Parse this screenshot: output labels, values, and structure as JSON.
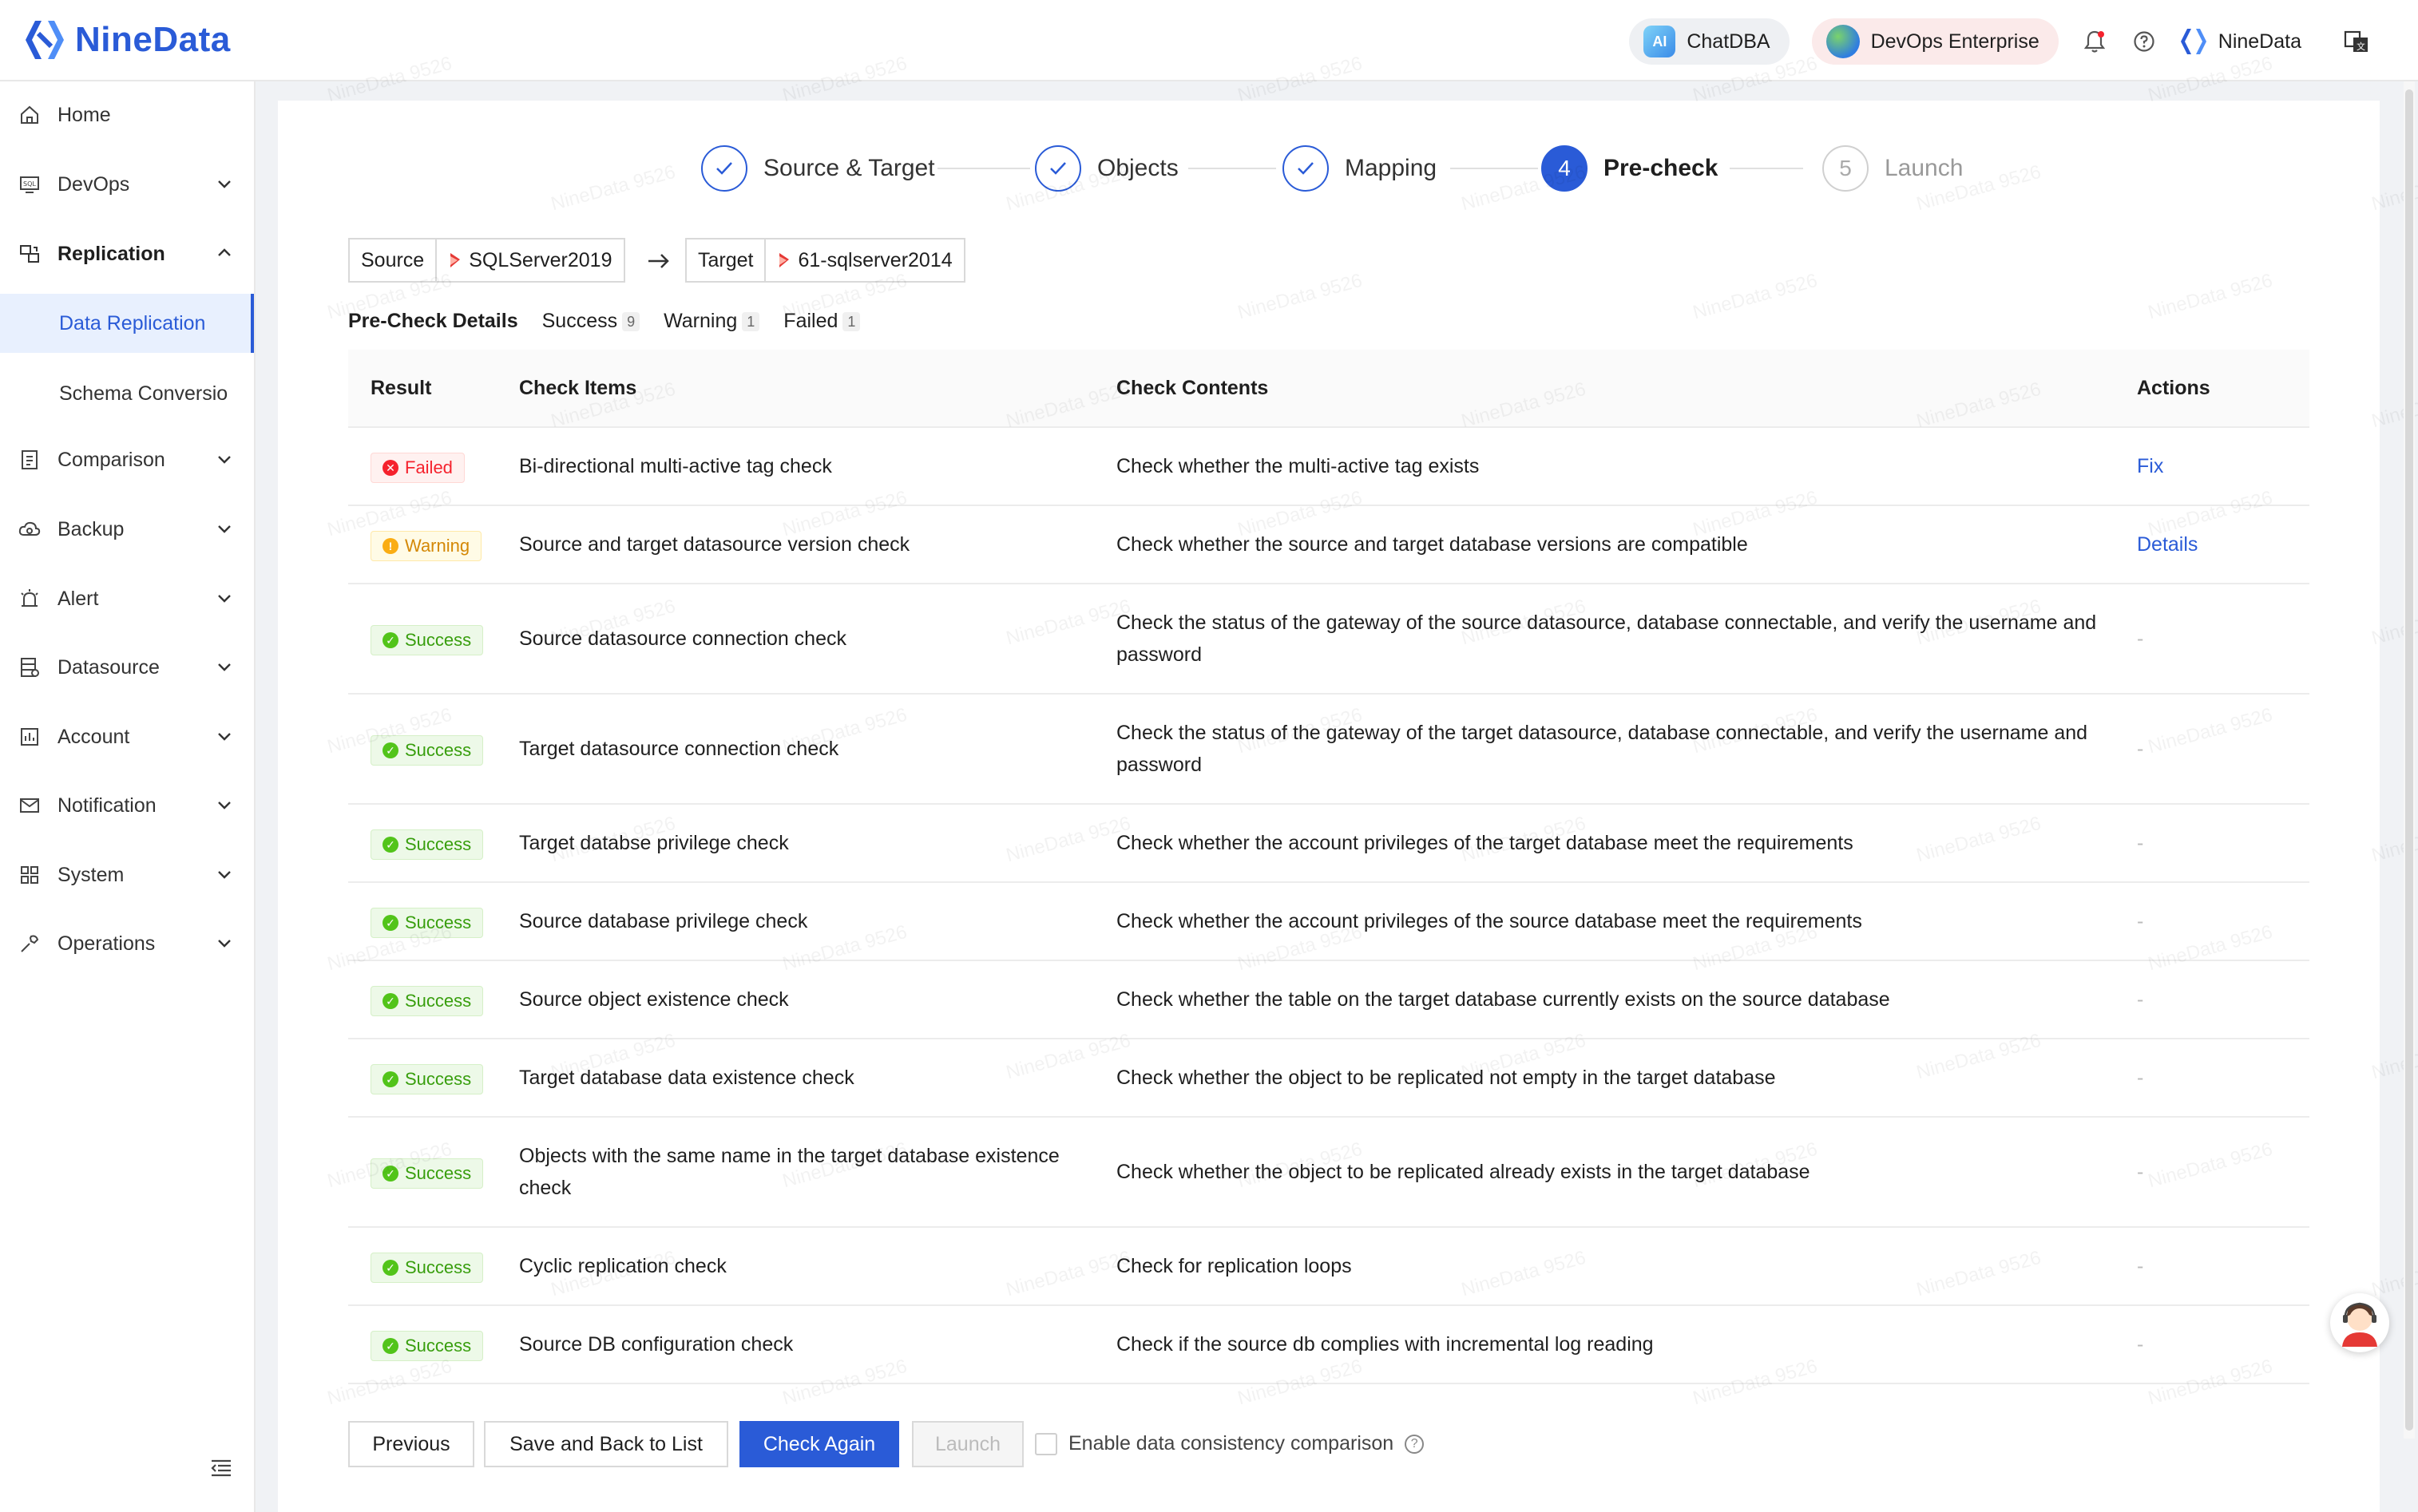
{
  "brand": {
    "name": "NineData",
    "color": "#2a5bd7"
  },
  "header": {
    "chatdba": "ChatDBA",
    "chatdba_icon": "AI",
    "edition": "DevOps Enterprise",
    "user": "NineData"
  },
  "sidebar": {
    "items": [
      {
        "label": "Home",
        "icon": "home-icon"
      },
      {
        "label": "DevOps",
        "icon": "devops-icon"
      },
      {
        "label": "Replication",
        "icon": "replication-icon",
        "expanded": true
      },
      {
        "label": "Comparison",
        "icon": "comparison-icon"
      },
      {
        "label": "Backup",
        "icon": "backup-icon"
      },
      {
        "label": "Alert",
        "icon": "alert-icon"
      },
      {
        "label": "Datasource",
        "icon": "datasource-icon"
      },
      {
        "label": "Account",
        "icon": "account-icon"
      },
      {
        "label": "Notification",
        "icon": "notification-icon"
      },
      {
        "label": "System",
        "icon": "system-icon"
      },
      {
        "label": "Operations",
        "icon": "operations-icon"
      }
    ],
    "sub_items": [
      {
        "label": "Data Replication",
        "active": true
      },
      {
        "label": "Schema Conversio",
        "active": false
      }
    ]
  },
  "steps": [
    {
      "number": "1",
      "label": "Source & Target",
      "state": "done"
    },
    {
      "number": "2",
      "label": "Objects",
      "state": "done"
    },
    {
      "number": "3",
      "label": "Mapping",
      "state": "done"
    },
    {
      "number": "4",
      "label": "Pre-check",
      "state": "current"
    },
    {
      "number": "5",
      "label": "Launch",
      "state": "todo"
    }
  ],
  "source_target": {
    "source_label": "Source",
    "source_value": "SQLServer2019",
    "target_label": "Target",
    "target_value": "61-sqlserver2014"
  },
  "precheck": {
    "title": "Pre-Check Details",
    "success_label": "Success",
    "success_count": "9",
    "warning_label": "Warning",
    "warning_count": "1",
    "failed_label": "Failed",
    "failed_count": "1"
  },
  "table": {
    "headers": {
      "result": "Result",
      "items": "Check Items",
      "contents": "Check Contents",
      "actions": "Actions"
    },
    "rows": [
      {
        "result": "Failed",
        "status": "failed",
        "item": "Bi-directional multi-active tag check",
        "content": "Check whether the multi-active tag exists",
        "action": "Fix"
      },
      {
        "result": "Warning",
        "status": "warning",
        "item": "Source and target datasource version check",
        "content": "Check whether the source and target database versions are compatible",
        "action": "Details"
      },
      {
        "result": "Success",
        "status": "success",
        "item": "Source datasource connection check",
        "content": "Check the status of the gateway of the source datasource, database connectable, and verify the username and password",
        "action": "-"
      },
      {
        "result": "Success",
        "status": "success",
        "item": "Target datasource connection check",
        "content": "Check the status of the gateway of the target datasource, database connectable, and verify the username and password",
        "action": "-"
      },
      {
        "result": "Success",
        "status": "success",
        "item": "Target databse privilege check",
        "content": "Check whether the account privileges of the target database meet the requirements",
        "action": "-"
      },
      {
        "result": "Success",
        "status": "success",
        "item": "Source database privilege check",
        "content": "Check whether the account privileges of the source database meet the requirements",
        "action": "-"
      },
      {
        "result": "Success",
        "status": "success",
        "item": "Source object existence check",
        "content": "Check whether the table on the target database currently exists on the source database",
        "action": "-"
      },
      {
        "result": "Success",
        "status": "success",
        "item": "Target database data existence check",
        "content": "Check whether the object to be replicated not empty in the target database",
        "action": "-"
      },
      {
        "result": "Success",
        "status": "success",
        "item": "Objects with the same name in the target database existence check",
        "content": "Check whether the object to be replicated already exists in the target database",
        "action": "-"
      },
      {
        "result": "Success",
        "status": "success",
        "item": "Cyclic replication check",
        "content": "Check for replication loops",
        "action": "-"
      },
      {
        "result": "Success",
        "status": "success",
        "item": "Source DB configuration check",
        "content": "Check if the source db complies with incremental log reading",
        "action": "-"
      }
    ]
  },
  "footer": {
    "previous": "Previous",
    "save_back": "Save and Back to List",
    "check_again": "Check Again",
    "launch": "Launch",
    "consistency_label": "Enable data consistency comparison"
  },
  "watermark": "NineData 9526"
}
